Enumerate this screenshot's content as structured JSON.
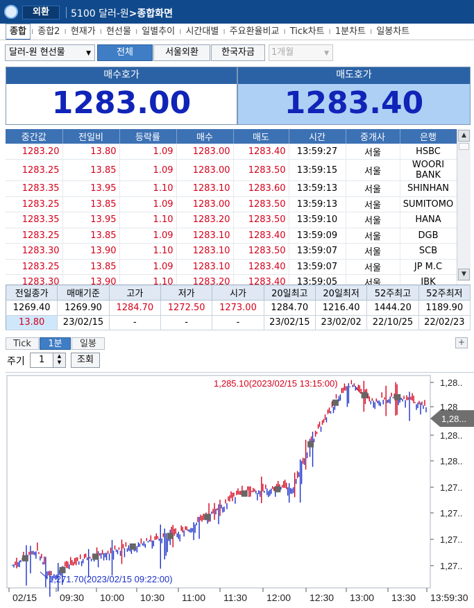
{
  "window": {
    "badge": "외환",
    "code": "5100",
    "name": "달러-원",
    "title": "종합화면"
  },
  "tabs": [
    "종합",
    "종합2",
    "현재가",
    "현선물",
    "일별추이",
    "시간대별",
    "주요환율비교",
    "Tick차트",
    "1분차트",
    "일봉차트"
  ],
  "controls": {
    "product": "달러-원 현선물",
    "filters": [
      "전체",
      "서울외환",
      "한국자금"
    ],
    "active_filter": "전체",
    "period_select": "1개월"
  },
  "quote": {
    "bid_label": "매수호가",
    "bid": "1283.00",
    "ask_label": "매도호가",
    "ask": "1283.40"
  },
  "trades": {
    "headers": [
      "중간값",
      "전일비",
      "등락률",
      "매수",
      "매도",
      "시간",
      "중개사",
      "은행"
    ],
    "rows": [
      [
        "1283.20",
        "13.80",
        "1.09",
        "1283.00",
        "1283.40",
        "13:59:27",
        "서울",
        "HSBC"
      ],
      [
        "1283.25",
        "13.85",
        "1.09",
        "1283.00",
        "1283.50",
        "13:59:15",
        "서울",
        "WOORI BANK"
      ],
      [
        "1283.35",
        "13.95",
        "1.10",
        "1283.10",
        "1283.60",
        "13:59:13",
        "서울",
        "SHINHAN"
      ],
      [
        "1283.25",
        "13.85",
        "1.09",
        "1283.00",
        "1283.50",
        "13:59:13",
        "서울",
        "SUMITOMO"
      ],
      [
        "1283.35",
        "13.95",
        "1.10",
        "1283.20",
        "1283.50",
        "13:59:10",
        "서울",
        "HANA"
      ],
      [
        "1283.25",
        "13.85",
        "1.09",
        "1283.10",
        "1283.40",
        "13:59:09",
        "서울",
        "DGB"
      ],
      [
        "1283.30",
        "13.90",
        "1.10",
        "1283.10",
        "1283.50",
        "13:59:07",
        "서울",
        "SCB"
      ],
      [
        "1283.25",
        "13.85",
        "1.09",
        "1283.10",
        "1283.40",
        "13:59:07",
        "서울",
        "JP M.C"
      ],
      [
        "1283.30",
        "13.90",
        "1.10",
        "1283.20",
        "1283.40",
        "13:59:05",
        "서울",
        "IBK"
      ]
    ]
  },
  "summary": {
    "headers": [
      "전일종가",
      "매매기준",
      "고가",
      "저가",
      "시가",
      "20일최고",
      "20일최저",
      "52주최고",
      "52주최저"
    ],
    "row1": [
      "1269.40",
      "1269.90",
      "1284.70",
      "1272.50",
      "1273.00",
      "1284.70",
      "1216.40",
      "1444.20",
      "1189.90"
    ],
    "row2": [
      "13.80",
      "23/02/15",
      "-",
      "-",
      "-",
      "23/02/15",
      "23/02/02",
      "22/10/25",
      "22/02/23"
    ]
  },
  "chart_tabs": [
    "Tick",
    "1분",
    "일봉"
  ],
  "chart_tab_active": "1분",
  "period_label": "주기",
  "period_value": "1",
  "lookup_label": "조회",
  "chart_data": {
    "type": "line",
    "x_ticks": [
      "02/15",
      "09:30",
      "10:00",
      "10:30",
      "11:00",
      "11:30",
      "12:00",
      "12:30",
      "13:00",
      "13:30",
      "13:59:30"
    ],
    "y_ticks": [
      "1,28..",
      "1,28",
      "1,28..",
      "1,28..",
      "1,27..",
      "1,27..",
      "1,27..",
      "1,27.."
    ],
    "current_label": "1,28...",
    "max_annotation": "1,285.10(2023/02/15 13:15:00)",
    "min_annotation": "1,271.70(2023/02/15 09:22:00)",
    "high": 1285.1,
    "low": 1271.7,
    "colors": {
      "up": "#d4001a",
      "down": "#1a2fc8",
      "marker": "#666666",
      "current": "#6f6f6f"
    }
  }
}
